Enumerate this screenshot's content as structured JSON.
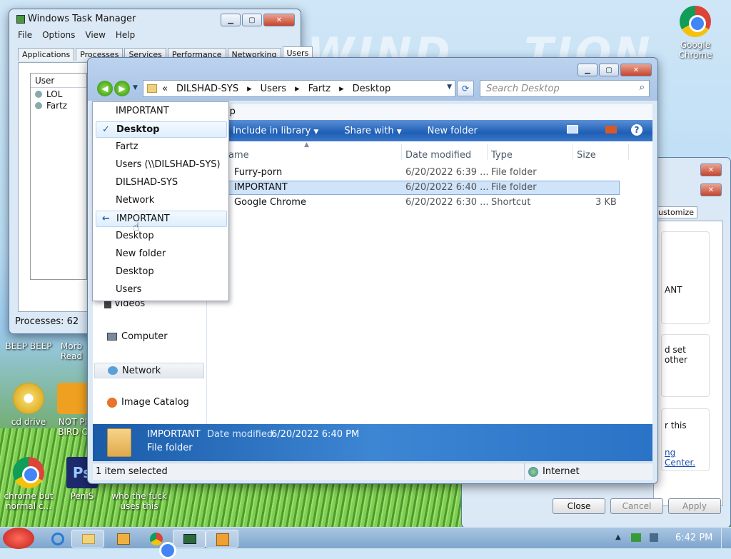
{
  "desktop": {
    "icons": [
      {
        "label": "Google Chrome"
      },
      {
        "label": "BEEP BEEP"
      },
      {
        "label": "Morb Read"
      },
      {
        "label": "cd drive"
      },
      {
        "label": "NOT PI BIRD C"
      },
      {
        "label": "chrome but normal c..."
      },
      {
        "label": "PeniS"
      },
      {
        "label": "who the fuck uses this"
      }
    ]
  },
  "task_manager": {
    "title": "Windows Task Manager",
    "menu": [
      "File",
      "Options",
      "View",
      "Help"
    ],
    "tabs": [
      "Applications",
      "Processes",
      "Services",
      "Performance",
      "Networking",
      "Users"
    ],
    "active_tab": "Users",
    "column": "User",
    "users": [
      "LOL",
      "Fartz"
    ],
    "status": "Processes: 62"
  },
  "explorer": {
    "breadcrumb": [
      "«",
      "DILSHAD-SYS",
      "Users",
      "Fartz",
      "Desktop"
    ],
    "search_placeholder": "Search Desktop",
    "menubar_visible": "lp",
    "commands": [
      "Include in library",
      "Share with",
      "New folder"
    ],
    "columns": {
      "name": "ame",
      "date": "Date modified",
      "type": "Type",
      "size": "Size"
    },
    "files": [
      {
        "name": "Furry-porn",
        "date": "6/20/2022 6:39 ...",
        "type": "File folder",
        "size": ""
      },
      {
        "name": "IMPORTANT",
        "date": "6/20/2022 6:40 ...",
        "type": "File folder",
        "size": ""
      },
      {
        "name": "Google Chrome",
        "date": "6/20/2022 6:30 ...",
        "type": "Shortcut",
        "size": "3 KB"
      }
    ],
    "nav_items": [
      "Videos",
      "Computer",
      "Network",
      "Image Catalog"
    ],
    "details": {
      "name": "IMPORTANT",
      "date_label": "Date modified:",
      "date_value": "6/20/2022 6:40 PM",
      "type": "File folder"
    },
    "status_left": "1 item selected",
    "status_right": "Internet"
  },
  "history_dropdown": {
    "items": [
      "IMPORTANT",
      "Desktop",
      "Fartz",
      "Users (\\\\DILSHAD-SYS)",
      "DILSHAD-SYS",
      "Network",
      "IMPORTANT",
      "Desktop",
      "New folder",
      "Desktop",
      "Users"
    ]
  },
  "back_dialog": {
    "tab_fragment": "ustomize",
    "text_fragments": [
      "ANT",
      "d set other",
      "r this",
      "ng Center."
    ],
    "buttons": [
      "Close",
      "Cancel",
      "Apply"
    ]
  },
  "taskbar": {
    "time": "6:42 PM"
  }
}
